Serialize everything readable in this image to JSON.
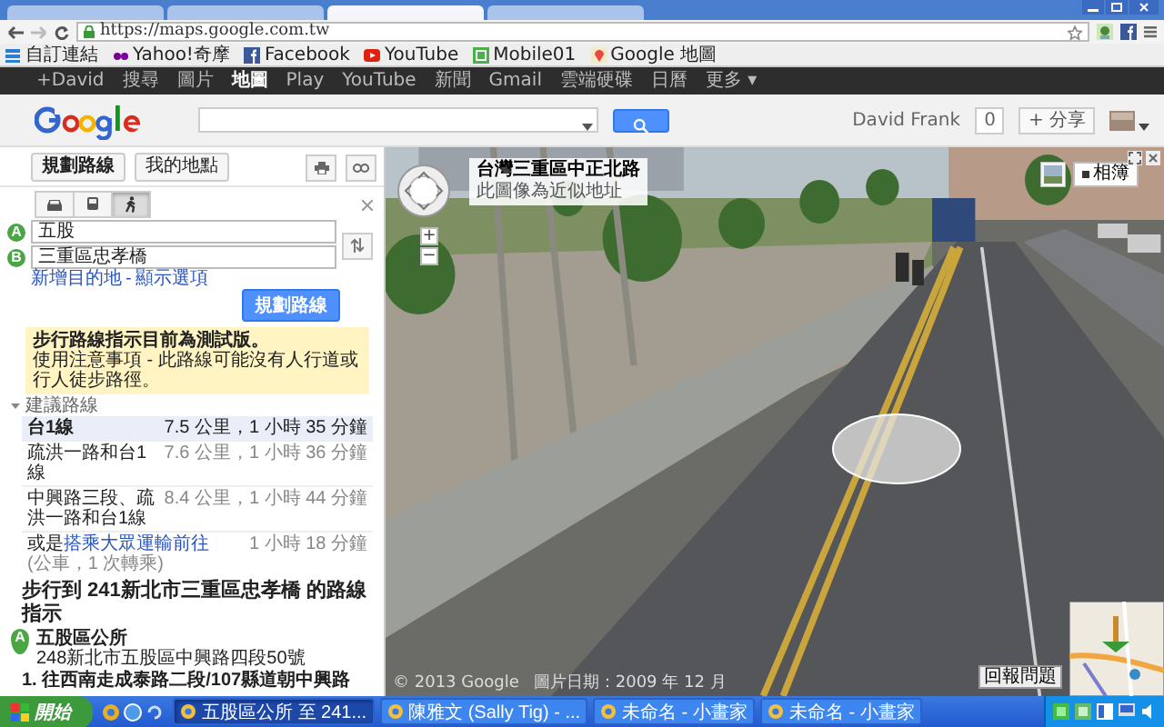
{
  "browser": {
    "tabs": [
      {
        "selected": false
      },
      {
        "selected": false
      },
      {
        "selected": true
      },
      {
        "selected": false
      }
    ],
    "url": "https://maps.google.com.tw",
    "bookmarks": [
      {
        "kind": "apps",
        "label": "自訂連結"
      },
      {
        "kind": "yahoo",
        "label": "Yahoo!奇摩"
      },
      {
        "kind": "facebook",
        "label": "Facebook"
      },
      {
        "kind": "youtube",
        "label": "YouTube"
      },
      {
        "kind": "mobile",
        "label": "Mobile01"
      },
      {
        "kind": "maps",
        "label": "Google 地圖"
      }
    ]
  },
  "google_bar": {
    "items": [
      {
        "label": "+David",
        "selected": false
      },
      {
        "label": "搜尋",
        "selected": false
      },
      {
        "label": "圖片",
        "selected": false
      },
      {
        "label": "地圖",
        "selected": true
      },
      {
        "label": "Play",
        "selected": false
      },
      {
        "label": "YouTube",
        "selected": false
      },
      {
        "label": "新聞",
        "selected": false
      },
      {
        "label": "Gmail",
        "selected": false
      },
      {
        "label": "雲端硬碟",
        "selected": false
      },
      {
        "label": "日曆",
        "selected": false
      },
      {
        "label": "更多 ▾",
        "selected": false
      }
    ]
  },
  "header": {
    "user": "David Frank",
    "notifications": "0",
    "share": "+ 分享"
  },
  "panel": {
    "buttons": [
      "規劃路線",
      "我的地點"
    ],
    "modes": [
      {
        "kind": "car",
        "selected": false
      },
      {
        "kind": "transit",
        "selected": false
      },
      {
        "kind": "walk",
        "selected": true
      }
    ],
    "waypoints": [
      {
        "marker": "A",
        "value": "五股"
      },
      {
        "marker": "B",
        "value": "三重區忠孝橋"
      }
    ],
    "links": [
      "新增目的地",
      "顯示選項"
    ],
    "link_separator": "-",
    "plan_button": "規劃路線",
    "notice": {
      "title": "步行路線指示目前為測試版。",
      "body": "使用注意事項 - 此路線可能沒有人行道或行人徒步路徑。"
    },
    "suggested_heading": "建議路線",
    "routes": [
      {
        "name": "台1線",
        "detail": "7.5 公里，1 小時 35 分鐘",
        "selected": true
      },
      {
        "name": "疏洪一路和台1線",
        "detail": "7.6 公里，1 小時 36 分鐘",
        "selected": false
      },
      {
        "name": "中興路三段、疏洪一路和台1線",
        "detail": "8.4 公里，1 小時 44 分鐘",
        "selected": false
      }
    ],
    "transit": {
      "prefix": "或是",
      "link": "搭乘大眾運輸前往",
      "note": "(公車，1 次轉乘)",
      "time": "1 小時 18 分鐘"
    },
    "directions_title": "步行到 241新北市三重區忠孝橋 的路線指示",
    "start": {
      "marker": "A",
      "name": "五股區公所",
      "address": "248新北市五股區中興路四段50號"
    },
    "steps": [
      "1. 往西南走成泰路二段/107縣道朝中興路"
    ]
  },
  "street_view": {
    "location": "台灣三重區中正北路",
    "note": "此圖像為近似地址",
    "zoom": [
      "+",
      "−"
    ],
    "photos_button": "相簿",
    "copyright": "© 2013 Google",
    "image_date": "圖片日期：2009 年 12 月",
    "report": "回報問題"
  },
  "taskbar": {
    "start": "開始",
    "items": [
      {
        "label": "五股區公所 至 241...",
        "selected": true
      },
      {
        "label": "陳雅文 (Sally Tig) - ...",
        "selected": false
      },
      {
        "label": "未命名 - 小畫家",
        "selected": false
      },
      {
        "label": "未命名 - 小畫家",
        "selected": false
      }
    ]
  }
}
